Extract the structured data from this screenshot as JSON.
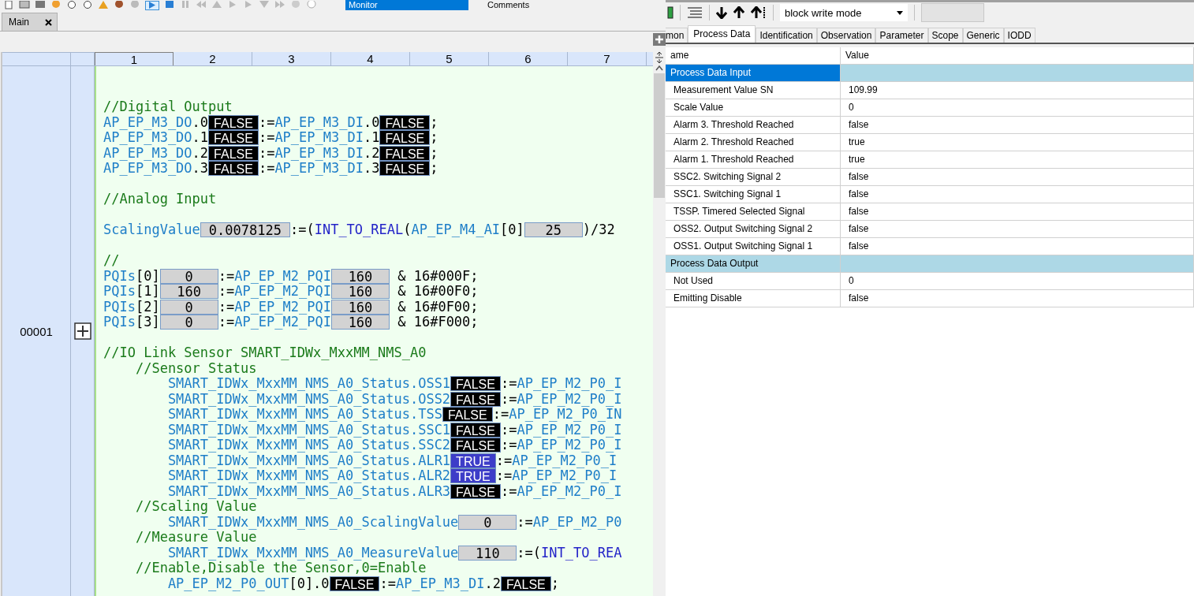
{
  "editor": {
    "toolbar": {
      "mode": "Monitor",
      "comments_label": "Comments"
    },
    "tabs": [
      {
        "label": "Main",
        "selected": true
      }
    ],
    "columns": [
      "1",
      "2",
      "3",
      "4",
      "5",
      "6",
      "7"
    ],
    "row_number": "00001",
    "lines": [
      {
        "kind": "blank"
      },
      {
        "kind": "blank"
      },
      {
        "kind": "code",
        "segments": [
          {
            "kind": "cm",
            "text": "//Digital Output"
          }
        ]
      },
      {
        "kind": "code",
        "segments": [
          {
            "kind": "id",
            "text": "AP_EP_M3_DO"
          },
          {
            "kind": "txt",
            "text": ".0"
          },
          {
            "kind": "bool",
            "text": "FALSE",
            "on": false
          },
          {
            "kind": "txt",
            "text": ":="
          },
          {
            "kind": "id",
            "text": "AP_EP_M3_DI"
          },
          {
            "kind": "txt",
            "text": ".0"
          },
          {
            "kind": "bool",
            "text": "FALSE",
            "on": false
          },
          {
            "kind": "txt",
            "text": ";"
          }
        ]
      },
      {
        "kind": "code",
        "segments": [
          {
            "kind": "id",
            "text": "AP_EP_M3_DO"
          },
          {
            "kind": "txt",
            "text": ".1"
          },
          {
            "kind": "bool",
            "text": "FALSE",
            "on": false
          },
          {
            "kind": "txt",
            "text": ":="
          },
          {
            "kind": "id",
            "text": "AP_EP_M3_DI"
          },
          {
            "kind": "txt",
            "text": ".1"
          },
          {
            "kind": "bool",
            "text": "FALSE",
            "on": false
          },
          {
            "kind": "txt",
            "text": ";"
          }
        ]
      },
      {
        "kind": "code",
        "segments": [
          {
            "kind": "id",
            "text": "AP_EP_M3_DO"
          },
          {
            "kind": "txt",
            "text": ".2"
          },
          {
            "kind": "bool",
            "text": "FALSE",
            "on": false
          },
          {
            "kind": "txt",
            "text": ":="
          },
          {
            "kind": "id",
            "text": "AP_EP_M3_DI"
          },
          {
            "kind": "txt",
            "text": ".2"
          },
          {
            "kind": "bool",
            "text": "FALSE",
            "on": false
          },
          {
            "kind": "txt",
            "text": ";"
          }
        ]
      },
      {
        "kind": "code",
        "segments": [
          {
            "kind": "id",
            "text": "AP_EP_M3_DO"
          },
          {
            "kind": "txt",
            "text": ".3"
          },
          {
            "kind": "bool",
            "text": "FALSE",
            "on": false
          },
          {
            "kind": "txt",
            "text": ":="
          },
          {
            "kind": "id",
            "text": "AP_EP_M3_DI"
          },
          {
            "kind": "txt",
            "text": ".3"
          },
          {
            "kind": "bool",
            "text": "FALSE",
            "on": false
          },
          {
            "kind": "txt",
            "text": ";"
          }
        ]
      },
      {
        "kind": "blank"
      },
      {
        "kind": "code",
        "segments": [
          {
            "kind": "cm",
            "text": "//Analog Input"
          }
        ]
      },
      {
        "kind": "blank"
      },
      {
        "kind": "code",
        "segments": [
          {
            "kind": "id",
            "text": "ScalingValue"
          },
          {
            "kind": "num",
            "text": "0.0078125"
          },
          {
            "kind": "txt",
            "text": ":=("
          },
          {
            "kind": "fn",
            "text": "INT_TO_REAL"
          },
          {
            "kind": "txt",
            "text": "("
          },
          {
            "kind": "id",
            "text": "AP_EP_M4_AI"
          },
          {
            "kind": "txt",
            "text": "[0]"
          },
          {
            "kind": "num",
            "text": "25"
          },
          {
            "kind": "txt",
            "text": ")/32"
          }
        ]
      },
      {
        "kind": "blank"
      },
      {
        "kind": "code",
        "segments": [
          {
            "kind": "cm",
            "text": "//"
          }
        ]
      },
      {
        "kind": "code",
        "segments": [
          {
            "kind": "id",
            "text": "PQIs"
          },
          {
            "kind": "txt",
            "text": "[0]"
          },
          {
            "kind": "num",
            "text": "0"
          },
          {
            "kind": "txt",
            "text": ":="
          },
          {
            "kind": "id",
            "text": "AP_EP_M2_PQI"
          },
          {
            "kind": "num",
            "text": "160"
          },
          {
            "kind": "txt",
            "text": " & 16#000F;"
          }
        ]
      },
      {
        "kind": "code",
        "segments": [
          {
            "kind": "id",
            "text": "PQIs"
          },
          {
            "kind": "txt",
            "text": "[1]"
          },
          {
            "kind": "num",
            "text": "160"
          },
          {
            "kind": "txt",
            "text": ":="
          },
          {
            "kind": "id",
            "text": "AP_EP_M2_PQI"
          },
          {
            "kind": "num",
            "text": "160"
          },
          {
            "kind": "txt",
            "text": " & 16#00F0;"
          }
        ]
      },
      {
        "kind": "code",
        "segments": [
          {
            "kind": "id",
            "text": "PQIs"
          },
          {
            "kind": "txt",
            "text": "[2]"
          },
          {
            "kind": "num",
            "text": "0"
          },
          {
            "kind": "txt",
            "text": ":="
          },
          {
            "kind": "id",
            "text": "AP_EP_M2_PQI"
          },
          {
            "kind": "num",
            "text": "160"
          },
          {
            "kind": "txt",
            "text": " & 16#0F00;"
          }
        ]
      },
      {
        "kind": "code",
        "segments": [
          {
            "kind": "id",
            "text": "PQIs"
          },
          {
            "kind": "txt",
            "text": "[3]"
          },
          {
            "kind": "num",
            "text": "0"
          },
          {
            "kind": "txt",
            "text": ":="
          },
          {
            "kind": "id",
            "text": "AP_EP_M2_PQI"
          },
          {
            "kind": "num",
            "text": "160"
          },
          {
            "kind": "txt",
            "text": " & 16#F000;"
          }
        ]
      },
      {
        "kind": "blank"
      },
      {
        "kind": "code",
        "segments": [
          {
            "kind": "cm",
            "text": "//IO Link Sensor SMART_IDWx_MxxMM_NMS_A0"
          }
        ]
      },
      {
        "kind": "code",
        "segments": [
          {
            "kind": "cm",
            "text": "    //Sensor Status"
          }
        ]
      },
      {
        "kind": "code",
        "segments": [
          {
            "kind": "id",
            "text": "        SMART_IDWx_MxxMM_NMS_A0_Status.OSS1"
          },
          {
            "kind": "bool",
            "text": "FALSE",
            "on": false
          },
          {
            "kind": "txt",
            "text": ":="
          },
          {
            "kind": "id",
            "text": "AP_EP_M2_P0_I"
          }
        ]
      },
      {
        "kind": "code",
        "segments": [
          {
            "kind": "id",
            "text": "        SMART_IDWx_MxxMM_NMS_A0_Status.OSS2"
          },
          {
            "kind": "bool",
            "text": "FALSE",
            "on": false
          },
          {
            "kind": "txt",
            "text": ":="
          },
          {
            "kind": "id",
            "text": "AP_EP_M2_P0_I"
          }
        ]
      },
      {
        "kind": "code",
        "segments": [
          {
            "kind": "id",
            "text": "        SMART_IDWx_MxxMM_NMS_A0_Status.TSS"
          },
          {
            "kind": "bool",
            "text": "FALSE",
            "on": false
          },
          {
            "kind": "txt",
            "text": ":="
          },
          {
            "kind": "id",
            "text": "AP_EP_M2_P0_IN"
          }
        ]
      },
      {
        "kind": "code",
        "segments": [
          {
            "kind": "id",
            "text": "        SMART_IDWx_MxxMM_NMS_A0_Status.SSC1"
          },
          {
            "kind": "bool",
            "text": "FALSE",
            "on": false
          },
          {
            "kind": "txt",
            "text": ":="
          },
          {
            "kind": "id",
            "text": "AP_EP_M2_P0_I"
          }
        ]
      },
      {
        "kind": "code",
        "segments": [
          {
            "kind": "id",
            "text": "        SMART_IDWx_MxxMM_NMS_A0_Status.SSC2"
          },
          {
            "kind": "bool",
            "text": "FALSE",
            "on": false
          },
          {
            "kind": "txt",
            "text": ":="
          },
          {
            "kind": "id",
            "text": "AP_EP_M2_P0_I"
          }
        ]
      },
      {
        "kind": "code",
        "segments": [
          {
            "kind": "id",
            "text": "        SMART_IDWx_MxxMM_NMS_A0_Status.ALR1"
          },
          {
            "kind": "bool",
            "text": "TRUE",
            "on": true
          },
          {
            "kind": "txt",
            "text": ":="
          },
          {
            "kind": "id",
            "text": "AP_EP_M2_P0_I"
          }
        ]
      },
      {
        "kind": "code",
        "segments": [
          {
            "kind": "id",
            "text": "        SMART_IDWx_MxxMM_NMS_A0_Status.ALR2"
          },
          {
            "kind": "bool",
            "text": "TRUE",
            "on": true
          },
          {
            "kind": "txt",
            "text": ":="
          },
          {
            "kind": "id",
            "text": "AP_EP_M2_P0_I"
          }
        ]
      },
      {
        "kind": "code",
        "segments": [
          {
            "kind": "id",
            "text": "        SMART_IDWx_MxxMM_NMS_A0_Status.ALR3"
          },
          {
            "kind": "bool",
            "text": "FALSE",
            "on": false
          },
          {
            "kind": "txt",
            "text": ":="
          },
          {
            "kind": "id",
            "text": "AP_EP_M2_P0_I"
          }
        ]
      },
      {
        "kind": "code",
        "segments": [
          {
            "kind": "cm",
            "text": "    //Scaling Value"
          }
        ]
      },
      {
        "kind": "code",
        "segments": [
          {
            "kind": "id",
            "text": "        SMART_IDWx_MxxMM_NMS_A0_ScalingValue"
          },
          {
            "kind": "num",
            "text": "0"
          },
          {
            "kind": "txt",
            "text": ":="
          },
          {
            "kind": "id",
            "text": "AP_EP_M2_P0"
          }
        ]
      },
      {
        "kind": "code",
        "segments": [
          {
            "kind": "cm",
            "text": "    //Measure Value"
          }
        ]
      },
      {
        "kind": "code",
        "segments": [
          {
            "kind": "id",
            "text": "        SMART_IDWx_MxxMM_NMS_A0_MeasureValue"
          },
          {
            "kind": "num",
            "text": "110"
          },
          {
            "kind": "txt",
            "text": ":=("
          },
          {
            "kind": "fn",
            "text": "INT_TO_REA"
          }
        ]
      },
      {
        "kind": "code",
        "segments": [
          {
            "kind": "cm",
            "text": "    //Enable,Disable the Sensor,0=Enable"
          }
        ]
      },
      {
        "kind": "code",
        "segments": [
          {
            "kind": "id",
            "text": "        AP_EP_M2_P0_OUT"
          },
          {
            "kind": "txt",
            "text": "[0].0"
          },
          {
            "kind": "bool",
            "text": "FALSE",
            "on": false
          },
          {
            "kind": "txt",
            "text": ":="
          },
          {
            "kind": "id",
            "text": "AP_EP_M3_DI"
          },
          {
            "kind": "txt",
            "text": ".2"
          },
          {
            "kind": "bool",
            "text": "FALSE",
            "on": false
          },
          {
            "kind": "txt",
            "text": ";"
          }
        ]
      }
    ]
  },
  "device_panel": {
    "mode": "block write mode",
    "tabs": [
      {
        "label": "mon",
        "selected": false
      },
      {
        "label": "Process Data",
        "selected": true
      },
      {
        "label": "Identification",
        "selected": false
      },
      {
        "label": "Observation",
        "selected": false
      },
      {
        "label": "Parameter",
        "selected": false
      },
      {
        "label": "Scope",
        "selected": false
      },
      {
        "label": "Generic",
        "selected": false
      },
      {
        "label": "IODD",
        "selected": false
      }
    ],
    "table": {
      "columns": [
        "ame",
        "Value"
      ],
      "rows": [
        {
          "kind": "group",
          "name": "Process Data Input",
          "selected": true
        },
        {
          "kind": "row",
          "name": "Measurement Value SN",
          "value": "109.99",
          "selected": false
        },
        {
          "kind": "row",
          "name": "Scale Value",
          "value": "0",
          "selected": false
        },
        {
          "kind": "row",
          "name": "Alarm 3. Threshold Reached",
          "value": "false",
          "selected": false
        },
        {
          "kind": "row",
          "name": "Alarm 2. Threshold Reached",
          "value": "true",
          "selected": false
        },
        {
          "kind": "row",
          "name": "Alarm 1. Threshold Reached",
          "value": "true",
          "selected": false
        },
        {
          "kind": "row",
          "name": "SSC2. Switching Signal 2",
          "value": "false",
          "selected": false
        },
        {
          "kind": "row",
          "name": "SSC1. Switching Signal 1",
          "value": "false",
          "selected": false
        },
        {
          "kind": "row",
          "name": "TSSP. Timered Selected Signal",
          "value": "false",
          "selected": false
        },
        {
          "kind": "row",
          "name": "OSS2. Output Switching Signal 2",
          "value": "false",
          "selected": false
        },
        {
          "kind": "row",
          "name": "OSS1. Output Switching Signal 1",
          "value": "false",
          "selected": false
        },
        {
          "kind": "group",
          "name": "Process Data Output",
          "selected": false
        },
        {
          "kind": "row",
          "name": "Not Used",
          "value": "0",
          "selected": false
        },
        {
          "kind": "row",
          "name": "Emitting Disable",
          "value": "false",
          "selected": false
        }
      ]
    }
  }
}
